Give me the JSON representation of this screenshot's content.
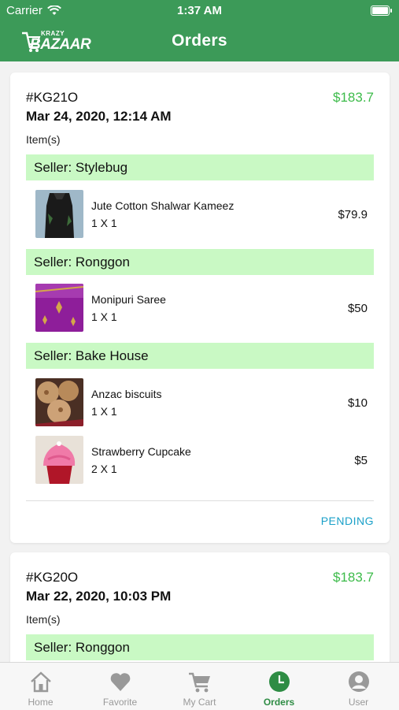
{
  "status_bar": {
    "carrier": "Carrier",
    "time": "1:37 AM"
  },
  "header": {
    "title": "Orders",
    "logo_top": "KRAZY",
    "logo_main": "BAZAAR"
  },
  "orders": [
    {
      "id": "#KG21O",
      "total": "$183.7",
      "date": "Mar 24, 2020, 12:14 AM",
      "items_label": "Item(s)",
      "sellers": [
        {
          "name": "Seller: Stylebug",
          "items": [
            {
              "name": "Jute Cotton Shalwar Kameez",
              "qty": "1 X 1",
              "price": "$79.9"
            }
          ]
        },
        {
          "name": "Seller: Ronggon",
          "items": [
            {
              "name": "Monipuri Saree",
              "qty": "1 X 1",
              "price": "$50"
            }
          ]
        },
        {
          "name": "Seller: Bake House",
          "items": [
            {
              "name": "Anzac biscuits",
              "qty": "1 X 1",
              "price": "$10"
            },
            {
              "name": "Strawberry Cupcake",
              "qty": "2 X 1",
              "price": "$5"
            }
          ]
        }
      ],
      "status": "PENDING"
    },
    {
      "id": "#KG20O",
      "total": "$183.7",
      "date": "Mar 22, 2020, 10:03 PM",
      "items_label": "Item(s)",
      "sellers": [
        {
          "name": "Seller: Ronggon",
          "items": []
        }
      ]
    }
  ],
  "tabs": [
    {
      "label": "Home",
      "icon": "home-icon"
    },
    {
      "label": "Favorite",
      "icon": "heart-icon"
    },
    {
      "label": "My Cart",
      "icon": "cart-icon"
    },
    {
      "label": "Orders",
      "icon": "clock-icon",
      "active": true
    },
    {
      "label": "User",
      "icon": "user-icon"
    }
  ],
  "colors": {
    "header": "#3c9a58",
    "price": "#3dbb4a",
    "seller_band": "#c9f9c4",
    "status": "#1aa0c8",
    "tab_active": "#2e8c44"
  }
}
